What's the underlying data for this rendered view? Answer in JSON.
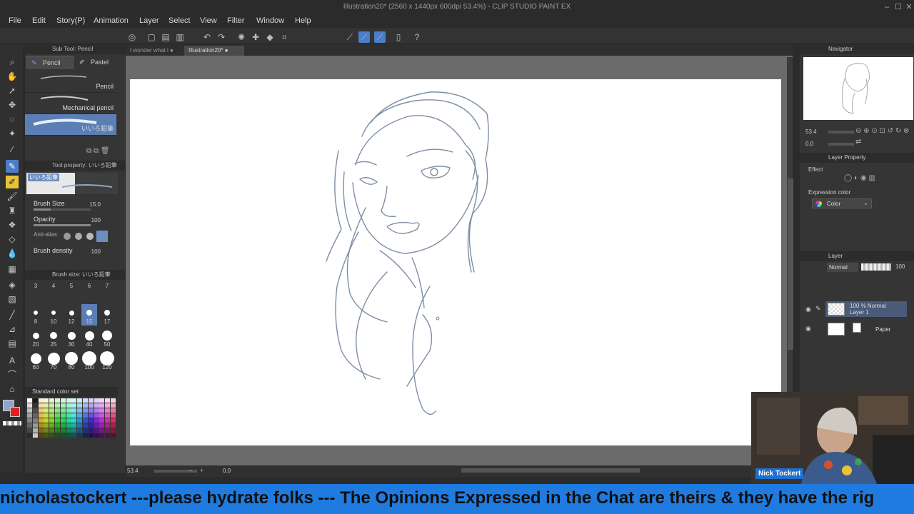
{
  "window": {
    "title": "Illustration20* (2560 x 1440px 600dpi 53.4%) - CLIP STUDIO PAINT EX"
  },
  "menu": [
    "File",
    "Edit",
    "Story(P)",
    "Animation",
    "Layer",
    "Select",
    "View",
    "Filter",
    "Window",
    "Help"
  ],
  "sub_tool": {
    "header": "Sub Tool: Pencil",
    "tabs": [
      "Pencil",
      "Pastel"
    ],
    "brushes": [
      "Pencil",
      "Mechanical pencil",
      "いいろ鉛筆"
    ]
  },
  "tool_property": {
    "header": "Tool property: いいろ鉛筆",
    "preview_label": "いいろ鉛筆",
    "brush_size_label": "Brush Size",
    "brush_size_value": "15.0",
    "opacity_label": "Opacity",
    "opacity_value": "100",
    "anti_alias_label": "Anti-alias",
    "brush_density_label": "Brush density",
    "brush_density_value": "100"
  },
  "brush_size_panel": {
    "header": "Brush size: いいろ鉛筆",
    "rows": [
      [
        "3",
        "4",
        "5",
        "6",
        "7"
      ],
      [
        "8",
        "10",
        "12",
        "15",
        "17"
      ],
      [
        "20",
        "25",
        "30",
        "40",
        "50"
      ],
      [
        "60",
        "70",
        "80",
        "100",
        "120"
      ]
    ],
    "selected": "15"
  },
  "color_set": {
    "label": "Standard color set"
  },
  "doc_tabs": [
    "I wonder what i",
    "Illustration20*"
  ],
  "status": {
    "zoom": "53.4",
    "rotation": "0.0"
  },
  "navigator": {
    "header": "Navigator",
    "zoom": "53.4",
    "rotation": "0.0"
  },
  "layer_property": {
    "header": "Layer Property",
    "effect_label": "Effect",
    "expression_color_label": "Expression color",
    "expression_color_value": "Color"
  },
  "layer_panel": {
    "header": "Layer",
    "blend_mode": "Normal",
    "opacity": "100",
    "layers": [
      {
        "line1": "100 % Normal",
        "line2": "Layer 1"
      },
      {
        "line1": "Paper",
        "line2": ""
      }
    ]
  },
  "webcam": {
    "name": "Nick Tockert"
  },
  "ticker": {
    "text": "nicholastockert ---please hydrate folks --- The Opinions Expressed in the Chat are theirs & they have the rig"
  },
  "colors": {
    "accent": "#4a7ec8",
    "ticker_bg": "#1f7be0",
    "sketch_stroke": "#7d8ea6"
  }
}
